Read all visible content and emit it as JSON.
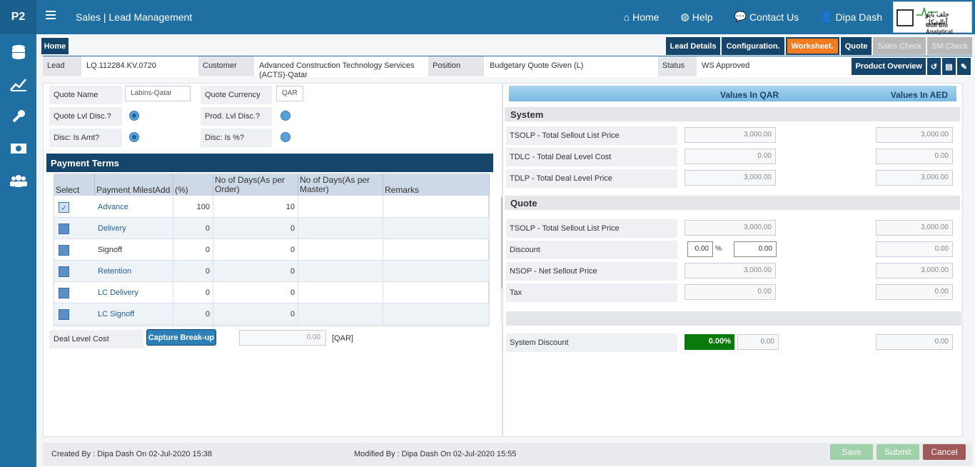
{
  "app": {
    "logo": "P2",
    "breadcrumb": "Sales  |  Lead Management"
  },
  "topnav": [
    {
      "label": "Home",
      "icon": "home-icon"
    },
    {
      "label": "Help",
      "icon": "globe-icon"
    },
    {
      "label": "Contact Us",
      "icon": "chat-icon"
    },
    {
      "label": "Dipa Dash",
      "icon": "user-icon"
    }
  ],
  "company": {
    "name_ar": "جلف بايو أناليتيكل",
    "name_en": "Gulf Bio Analytical"
  },
  "sidebar": [
    "database-icon",
    "chart-line-icon",
    "wrench-icon",
    "money-icon",
    "users-icon"
  ],
  "home_tab": "Home",
  "tabs": [
    {
      "label": "Lead Details",
      "state": "normal"
    },
    {
      "label": "Configuration.",
      "state": "normal"
    },
    {
      "label": "Worksheet.",
      "state": "active"
    },
    {
      "label": "Quote",
      "state": "normal"
    },
    {
      "label": "Sales Check",
      "state": "disabled"
    },
    {
      "label": "SM Check",
      "state": "disabled"
    }
  ],
  "info": {
    "lead_label": "Lead",
    "lead_value": "LQ.112284.KV.0720",
    "customer_label": "Customer",
    "customer_value": "Advanced Construction Technology Services (ACTS)-Qatar",
    "position_label": "Position",
    "position_value": "Budgetary Quote Given (L)",
    "status_label": "Status",
    "status_value": "WS Approved",
    "product_overview": "Product Overview"
  },
  "form": {
    "quote_name_label": "Quote Name",
    "quote_name_value": "Labins-Qatar",
    "quote_currency_label": "Quote Currency",
    "quote_currency_value": "QAR",
    "quote_lvl_label": "Quote Lvl Disc.?",
    "prod_lvl_label": "Prod. Lvl Disc.?",
    "disc_amt_label": "Disc: Is Amt?",
    "disc_pct_label": "Disc: Is %?"
  },
  "payment_terms": {
    "title": "Payment Terms",
    "headers": [
      "Select",
      "Payment MilestAdd",
      "(%)",
      "No of Days(As per Order)",
      "No of Days(As per Master)",
      "Remarks"
    ],
    "rows": [
      {
        "checked": true,
        "name": "Advance",
        "pct": "100",
        "days_order": "10",
        "days_master": "",
        "remarks": ""
      },
      {
        "checked": false,
        "name": "Delivery",
        "pct": "0",
        "days_order": "0",
        "days_master": "",
        "remarks": ""
      },
      {
        "checked": false,
        "name": "Signoff",
        "pct": "0",
        "days_order": "0",
        "days_master": "",
        "remarks": ""
      },
      {
        "checked": false,
        "name": "Retention",
        "pct": "0",
        "days_order": "0",
        "days_master": "",
        "remarks": ""
      },
      {
        "checked": false,
        "name": "LC Delivery",
        "pct": "0",
        "days_order": "0",
        "days_master": "",
        "remarks": ""
      },
      {
        "checked": false,
        "name": "LC Signoff",
        "pct": "0",
        "days_order": "0",
        "days_master": "",
        "remarks": ""
      }
    ]
  },
  "deal_cost": {
    "label": "Deal Level Cost",
    "button": "Capture Break-up",
    "value": "0.00",
    "currency": "[QAR]"
  },
  "values": {
    "header_qar": "Values In QAR",
    "header_aed": "Values In AED",
    "system_title": "System",
    "system": [
      {
        "label": "TSOLP - Total Sellout List Price",
        "qar": "3,000.00",
        "aed": "3,000.00"
      },
      {
        "label": "TDLC - Total Deal Level Cost",
        "qar": "0.00",
        "aed": "0.00"
      },
      {
        "label": "TDLP - Total Deal Level Price",
        "qar": "3,000.00",
        "aed": "3,000.00"
      }
    ],
    "quote_title": "Quote",
    "quote": [
      {
        "label": "TSOLP - Total Sellout List Price",
        "qar": "3,000.00",
        "aed": "3,000.00"
      },
      {
        "label": "Discount",
        "qar": "",
        "aed": "0.00"
      },
      {
        "label": "NSOP - Net Sellout Price",
        "qar": "3,000.00",
        "aed": "3,000.00"
      },
      {
        "label": "Tax",
        "qar": "0.00",
        "aed": "0.00"
      }
    ],
    "discount_pct": "0.00",
    "pct_sign": "%",
    "discount_amt": "0.00",
    "system_discount_label": "System Discount",
    "system_discount_pct": "0.00%",
    "system_discount_qar": "0.00",
    "system_discount_aed": "0.00"
  },
  "footer": {
    "created": "Created By : Dipa Dash On 02-Jul-2020 15:38",
    "modified": "Modified By : Dipa Dash On 02-Jul-2020 15:55",
    "save": "Save",
    "submit": "Submit",
    "cancel": "Cancel"
  }
}
